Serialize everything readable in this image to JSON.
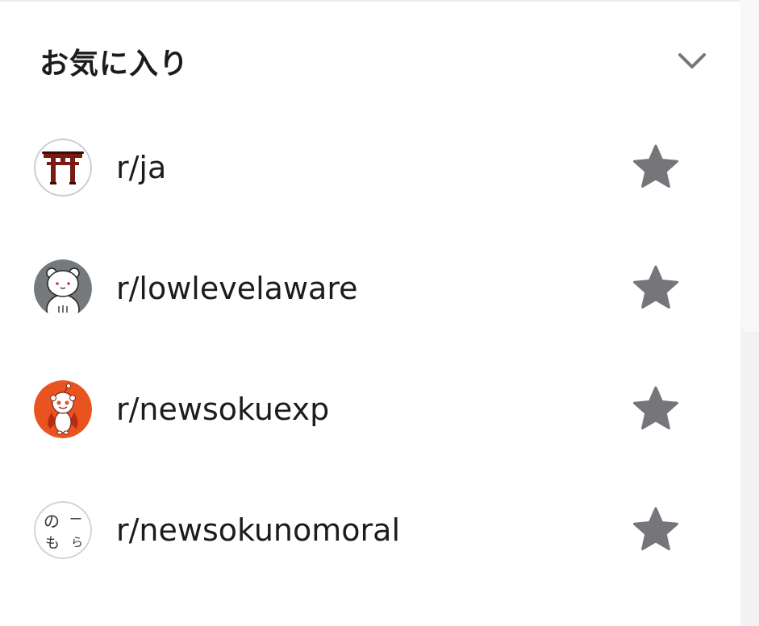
{
  "section": {
    "title": "お気に入り",
    "toggle_icon": "chevron-down-icon"
  },
  "favorites": [
    {
      "name": "r/ja",
      "avatar": "torii-gate",
      "favorited": true
    },
    {
      "name": "r/lowlevelaware",
      "avatar": "white-bear-on-gray",
      "favorited": true
    },
    {
      "name": "r/newsokuexp",
      "avatar": "snoo-on-orange",
      "favorited": true
    },
    {
      "name": "r/newsokunomoral",
      "avatar": "handwritten-hiragana",
      "favorited": true
    }
  ],
  "avatar_text": {
    "newsokunomoral": [
      "の",
      "ー",
      "も",
      "ら"
    ]
  },
  "colors": {
    "text": "#1c1c1c",
    "icon_gray": "#76767a",
    "orange": "#e8531f",
    "torii": "#7a1a12",
    "bear_bg": "#76797c"
  }
}
